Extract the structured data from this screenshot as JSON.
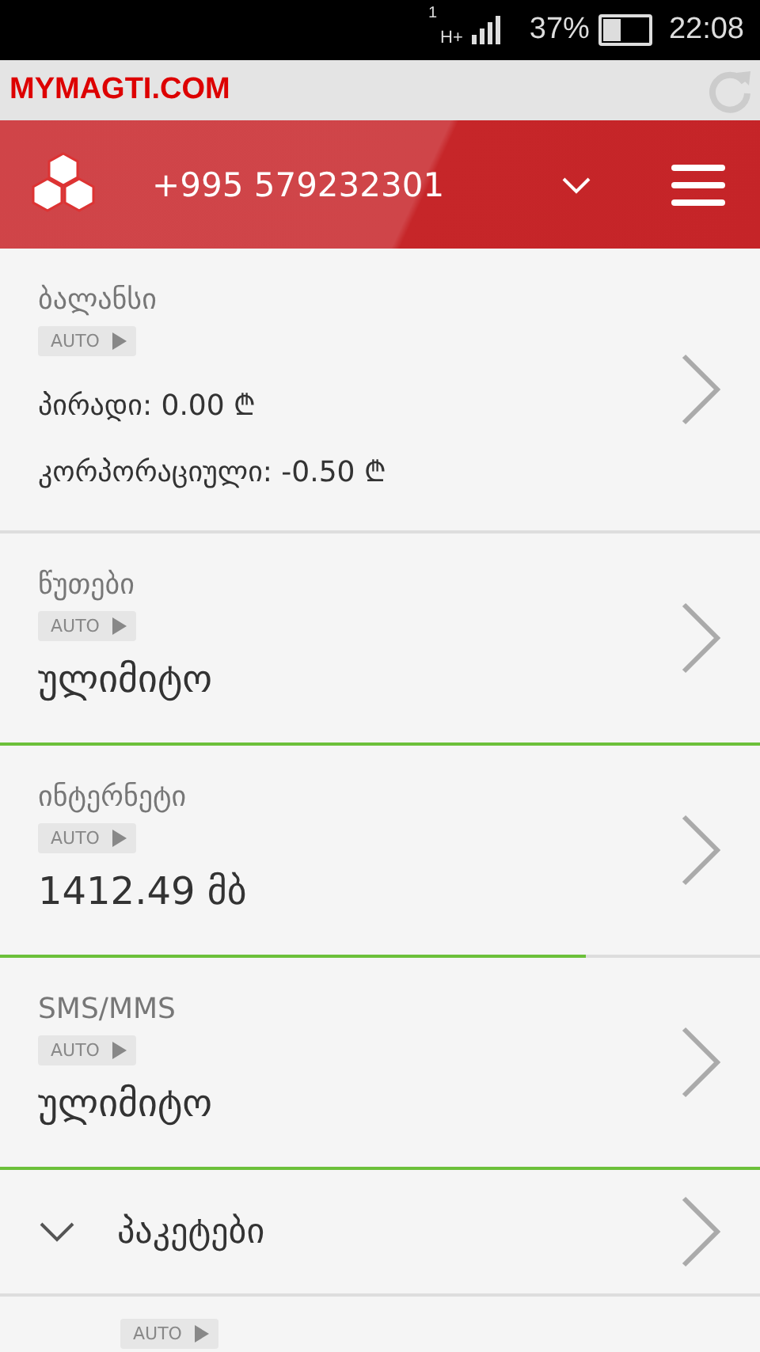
{
  "status_bar": {
    "sim": "1",
    "network": "H+",
    "battery_text": "37%",
    "time": "22:08"
  },
  "browser": {
    "url": "MYMAGTI.COM"
  },
  "header": {
    "phone": "+995 579232301"
  },
  "cards": [
    {
      "kind": "balance",
      "title": "ბალანსი",
      "tag": "AUTO",
      "lines": [
        "პირადი: 0.00 ₾",
        "კორპორაციული: -0.50 ₾"
      ]
    },
    {
      "kind": "value",
      "title": "წუთები",
      "tag": "AUTO",
      "value": "ულიმიტო",
      "level": 1
    },
    {
      "kind": "value",
      "title": "ინტერნეტი",
      "tag": "AUTO",
      "value": "1412.49 მბ",
      "level": 0.77
    },
    {
      "kind": "value",
      "title": "SMS/MMS",
      "tag": "AUTO",
      "value": "ულიმიტო",
      "level": 1
    },
    {
      "kind": "group",
      "title": "პაკეტები",
      "expanded": true
    }
  ],
  "sub_tag": "AUTO"
}
